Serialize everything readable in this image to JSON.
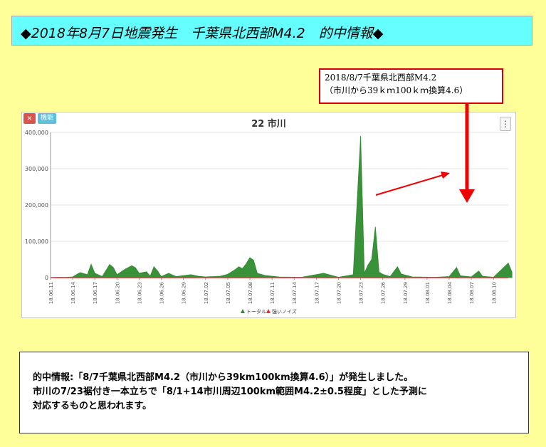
{
  "header": {
    "title": "◆2018年8月7日地震発生　千葉県北西部M4.2　的中情報◆"
  },
  "annotation": {
    "line1": "2018/8/7千葉県北西部M4.2",
    "line2": "（市川から39ｋｍ100ｋｍ換算4.6）"
  },
  "panel": {
    "close_label": "×",
    "func_label": "機能",
    "menu_label": "⋮"
  },
  "colors": {
    "total": "#2e8b2e",
    "noise": "#e03030",
    "arrow": "#ee0000"
  },
  "chart_data": {
    "type": "area",
    "title": "22 市川",
    "ylim": [
      0,
      400000
    ],
    "yticks": [
      "0",
      "100,000",
      "200,000",
      "300,000",
      "400,000"
    ],
    "grid": true,
    "legend_position": "bottom",
    "x_start": "2018-06-11",
    "x_end": "2018-08-12",
    "xticks": [
      "18.06.11",
      "18.06.14",
      "18.06.17",
      "18.06.20",
      "18.06.23",
      "18.06.26",
      "18.06.29",
      "18.07.02",
      "18.07.05",
      "18.07.08",
      "18.07.11",
      "18.07.14",
      "18.07.17",
      "18.07.20",
      "18.07.23",
      "18.07.26",
      "18.07.29",
      "18.08.01",
      "18.08.04",
      "18.08.07",
      "18.08.10"
    ],
    "series": [
      {
        "name": "トータル",
        "color": "#2e8b2e",
        "points": [
          [
            "2018-06-11",
            0
          ],
          [
            "2018-06-12",
            1000
          ],
          [
            "2018-06-13",
            800
          ],
          [
            "2018-06-14",
            2000
          ],
          [
            "2018-06-15",
            14000
          ],
          [
            "2018-06-16",
            8000
          ],
          [
            "2018-06-16.5",
            37000
          ],
          [
            "2018-06-17",
            12000
          ],
          [
            "2018-06-18",
            3000
          ],
          [
            "2018-06-19",
            36000
          ],
          [
            "2018-06-19.5",
            28000
          ],
          [
            "2018-06-20",
            8000
          ],
          [
            "2018-06-21",
            22000
          ],
          [
            "2018-06-22",
            33000
          ],
          [
            "2018-06-22.5",
            27000
          ],
          [
            "2018-06-23",
            12000
          ],
          [
            "2018-06-24",
            16000
          ],
          [
            "2018-06-24.5",
            4000
          ],
          [
            "2018-06-25",
            30000
          ],
          [
            "2018-06-25.5",
            18000
          ],
          [
            "2018-06-26",
            3000
          ],
          [
            "2018-06-27",
            12000
          ],
          [
            "2018-06-28",
            3000
          ],
          [
            "2018-06-30",
            8000
          ],
          [
            "2018-07-01",
            4000
          ],
          [
            "2018-07-02",
            2000
          ],
          [
            "2018-07-03",
            3000
          ],
          [
            "2018-07-04",
            4000
          ],
          [
            "2018-07-05",
            9000
          ],
          [
            "2018-07-06",
            22000
          ],
          [
            "2018-07-06.5",
            30000
          ],
          [
            "2018-07-07",
            25000
          ],
          [
            "2018-07-07.5",
            38000
          ],
          [
            "2018-07-08",
            55000
          ],
          [
            "2018-07-08.5",
            48000
          ],
          [
            "2018-07-09",
            12000
          ],
          [
            "2018-07-10",
            6000
          ],
          [
            "2018-07-12",
            1500
          ],
          [
            "2018-07-15",
            1000
          ],
          [
            "2018-07-18",
            12000
          ],
          [
            "2018-07-20",
            1000
          ],
          [
            "2018-07-22",
            8000
          ],
          [
            "2018-07-23",
            390000
          ],
          [
            "2018-07-23.5",
            12000
          ],
          [
            "2018-07-24",
            35000
          ],
          [
            "2018-07-24.5",
            50000
          ],
          [
            "2018-07-25",
            140000
          ],
          [
            "2018-07-25.5",
            15000
          ],
          [
            "2018-07-26",
            9000
          ],
          [
            "2018-07-27",
            3000
          ],
          [
            "2018-07-28",
            30000
          ],
          [
            "2018-07-28.5",
            10000
          ],
          [
            "2018-07-30",
            2000
          ],
          [
            "2018-08-02",
            1000
          ],
          [
            "2018-08-04",
            3000
          ],
          [
            "2018-08-05",
            28000
          ],
          [
            "2018-08-05.5",
            5000
          ],
          [
            "2018-08-07",
            2000
          ],
          [
            "2018-08-08",
            18000
          ],
          [
            "2018-08-08.5",
            4000
          ],
          [
            "2018-08-10",
            1000
          ],
          [
            "2018-08-12",
            40000
          ],
          [
            "2018-08-12.5",
            15000
          ]
        ]
      },
      {
        "name": "強いノイズ",
        "color": "#e03030",
        "points": [
          [
            "2018-06-11",
            0
          ],
          [
            "2018-08-12",
            0
          ]
        ]
      }
    ]
  },
  "info": {
    "line1": "的中情報:「8/7千葉県北西部M4.2（市川から39km100km換算4.6）」が発生しました。",
    "line2": "市川の7/23裾付き一本立ちで「8/1+14市川周辺100km範囲M4.2±0.5程度」とした予測に",
    "line3": "対応するものと思われます。"
  }
}
